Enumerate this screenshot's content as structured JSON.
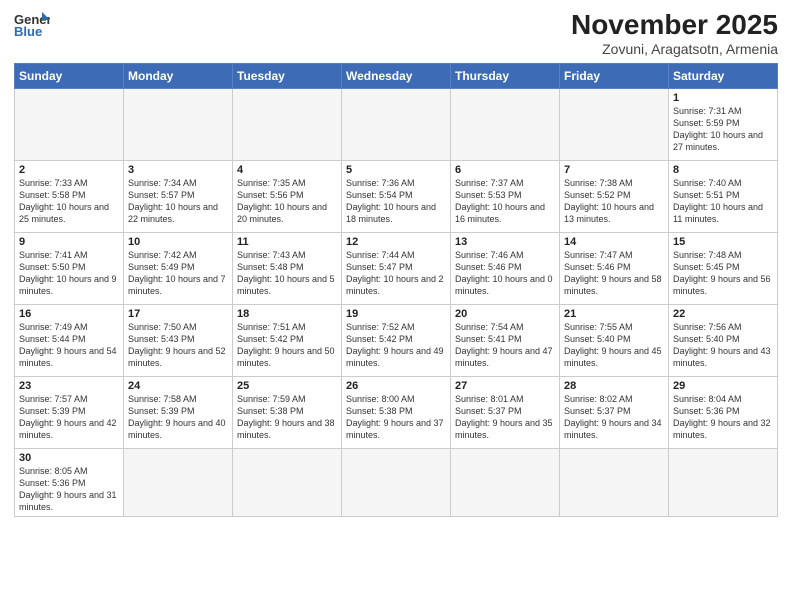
{
  "logo": {
    "text_general": "General",
    "text_blue": "Blue"
  },
  "header": {
    "month": "November 2025",
    "location": "Zovuni, Aragatsotn, Armenia"
  },
  "weekdays": [
    "Sunday",
    "Monday",
    "Tuesday",
    "Wednesday",
    "Thursday",
    "Friday",
    "Saturday"
  ],
  "weeks": [
    [
      {
        "day": "",
        "info": ""
      },
      {
        "day": "",
        "info": ""
      },
      {
        "day": "",
        "info": ""
      },
      {
        "day": "",
        "info": ""
      },
      {
        "day": "",
        "info": ""
      },
      {
        "day": "",
        "info": ""
      },
      {
        "day": "1",
        "info": "Sunrise: 7:31 AM\nSunset: 5:59 PM\nDaylight: 10 hours and 27 minutes."
      }
    ],
    [
      {
        "day": "2",
        "info": "Sunrise: 7:33 AM\nSunset: 5:58 PM\nDaylight: 10 hours and 25 minutes."
      },
      {
        "day": "3",
        "info": "Sunrise: 7:34 AM\nSunset: 5:57 PM\nDaylight: 10 hours and 22 minutes."
      },
      {
        "day": "4",
        "info": "Sunrise: 7:35 AM\nSunset: 5:56 PM\nDaylight: 10 hours and 20 minutes."
      },
      {
        "day": "5",
        "info": "Sunrise: 7:36 AM\nSunset: 5:54 PM\nDaylight: 10 hours and 18 minutes."
      },
      {
        "day": "6",
        "info": "Sunrise: 7:37 AM\nSunset: 5:53 PM\nDaylight: 10 hours and 16 minutes."
      },
      {
        "day": "7",
        "info": "Sunrise: 7:38 AM\nSunset: 5:52 PM\nDaylight: 10 hours and 13 minutes."
      },
      {
        "day": "8",
        "info": "Sunrise: 7:40 AM\nSunset: 5:51 PM\nDaylight: 10 hours and 11 minutes."
      }
    ],
    [
      {
        "day": "9",
        "info": "Sunrise: 7:41 AM\nSunset: 5:50 PM\nDaylight: 10 hours and 9 minutes."
      },
      {
        "day": "10",
        "info": "Sunrise: 7:42 AM\nSunset: 5:49 PM\nDaylight: 10 hours and 7 minutes."
      },
      {
        "day": "11",
        "info": "Sunrise: 7:43 AM\nSunset: 5:48 PM\nDaylight: 10 hours and 5 minutes."
      },
      {
        "day": "12",
        "info": "Sunrise: 7:44 AM\nSunset: 5:47 PM\nDaylight: 10 hours and 2 minutes."
      },
      {
        "day": "13",
        "info": "Sunrise: 7:46 AM\nSunset: 5:46 PM\nDaylight: 10 hours and 0 minutes."
      },
      {
        "day": "14",
        "info": "Sunrise: 7:47 AM\nSunset: 5:46 PM\nDaylight: 9 hours and 58 minutes."
      },
      {
        "day": "15",
        "info": "Sunrise: 7:48 AM\nSunset: 5:45 PM\nDaylight: 9 hours and 56 minutes."
      }
    ],
    [
      {
        "day": "16",
        "info": "Sunrise: 7:49 AM\nSunset: 5:44 PM\nDaylight: 9 hours and 54 minutes."
      },
      {
        "day": "17",
        "info": "Sunrise: 7:50 AM\nSunset: 5:43 PM\nDaylight: 9 hours and 52 minutes."
      },
      {
        "day": "18",
        "info": "Sunrise: 7:51 AM\nSunset: 5:42 PM\nDaylight: 9 hours and 50 minutes."
      },
      {
        "day": "19",
        "info": "Sunrise: 7:52 AM\nSunset: 5:42 PM\nDaylight: 9 hours and 49 minutes."
      },
      {
        "day": "20",
        "info": "Sunrise: 7:54 AM\nSunset: 5:41 PM\nDaylight: 9 hours and 47 minutes."
      },
      {
        "day": "21",
        "info": "Sunrise: 7:55 AM\nSunset: 5:40 PM\nDaylight: 9 hours and 45 minutes."
      },
      {
        "day": "22",
        "info": "Sunrise: 7:56 AM\nSunset: 5:40 PM\nDaylight: 9 hours and 43 minutes."
      }
    ],
    [
      {
        "day": "23",
        "info": "Sunrise: 7:57 AM\nSunset: 5:39 PM\nDaylight: 9 hours and 42 minutes."
      },
      {
        "day": "24",
        "info": "Sunrise: 7:58 AM\nSunset: 5:39 PM\nDaylight: 9 hours and 40 minutes."
      },
      {
        "day": "25",
        "info": "Sunrise: 7:59 AM\nSunset: 5:38 PM\nDaylight: 9 hours and 38 minutes."
      },
      {
        "day": "26",
        "info": "Sunrise: 8:00 AM\nSunset: 5:38 PM\nDaylight: 9 hours and 37 minutes."
      },
      {
        "day": "27",
        "info": "Sunrise: 8:01 AM\nSunset: 5:37 PM\nDaylight: 9 hours and 35 minutes."
      },
      {
        "day": "28",
        "info": "Sunrise: 8:02 AM\nSunset: 5:37 PM\nDaylight: 9 hours and 34 minutes."
      },
      {
        "day": "29",
        "info": "Sunrise: 8:04 AM\nSunset: 5:36 PM\nDaylight: 9 hours and 32 minutes."
      }
    ],
    [
      {
        "day": "30",
        "info": "Sunrise: 8:05 AM\nSunset: 5:36 PM\nDaylight: 9 hours and 31 minutes."
      },
      {
        "day": "",
        "info": ""
      },
      {
        "day": "",
        "info": ""
      },
      {
        "day": "",
        "info": ""
      },
      {
        "day": "",
        "info": ""
      },
      {
        "day": "",
        "info": ""
      },
      {
        "day": "",
        "info": ""
      }
    ]
  ]
}
